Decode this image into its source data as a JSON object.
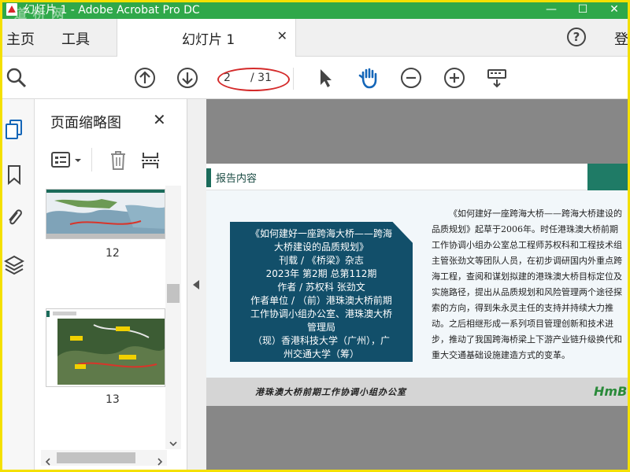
{
  "window": {
    "title": "幻灯片 1 - Adobe Acrobat Pro DC",
    "watermark": "道 桥 网",
    "controls": [
      "—",
      "☐",
      "✕"
    ]
  },
  "tabs": {
    "home": "主页",
    "tools": "工具",
    "document": "幻灯片 1",
    "help": "?",
    "login": "登"
  },
  "toolbar": {
    "page_current": "2",
    "page_total": "/ 31",
    "icons": [
      "search-icon",
      "prev-page-icon",
      "next-page-icon",
      "select-tool-icon",
      "hand-tool-icon",
      "zoom-out-icon",
      "zoom-in-icon",
      "keyboard-tools-icon"
    ],
    "annotation_color": "#d42a2a"
  },
  "sidebar": {
    "panel_title": "页面缩略图",
    "thumbnails": [
      {
        "page": "12"
      },
      {
        "page": "13"
      }
    ],
    "rail_icons": [
      "page-thumbnails-icon",
      "bookmark-icon",
      "attachment-icon",
      "layers-icon"
    ]
  },
  "slide": {
    "section_label": "报告内容",
    "card_lines": [
      "《如何建好一座跨海大桥——跨海",
      "大桥建设的品质规划》",
      "刊载 / 《桥梁》杂志",
      "2023年 第2期 总第112期",
      "作者 / 苏权科 张劲文",
      "作者单位 / （前）港珠澳大桥前期",
      "工作协调小组办公室、港珠澳大桥",
      "管理局",
      "（现）香港科技大学（广州），广",
      "州交通大学（筹）"
    ],
    "description": "《如何建好一座跨海大桥——跨海大桥建设的品质规划》起草于2006年。时任港珠澳大桥前期工作协调小组办公室总工程师苏权科和工程技术组主管张劲文等团队人员，在初步调研国内外重点跨海工程，查阅和谋划拟建的港珠澳大桥目标定位及实施路径，提出从品质规划和风险管理两个途径探索的方向，得到朱永灵主任的支持并持续大力推动。之后相继形成一系列项目管理创新和技术进步，推动了我国跨海桥梁上下游产业链升级换代和重大交通基础设施建造方式的变革。",
    "footer_text": "港珠澳大桥前期工作协调小组办公室",
    "footer_logo": "HmB",
    "colors": {
      "card": "#124f6a",
      "accent": "#1f7b66"
    }
  },
  "theme": {
    "titlebar": "#2fa84a",
    "frame": "#f4e000"
  }
}
